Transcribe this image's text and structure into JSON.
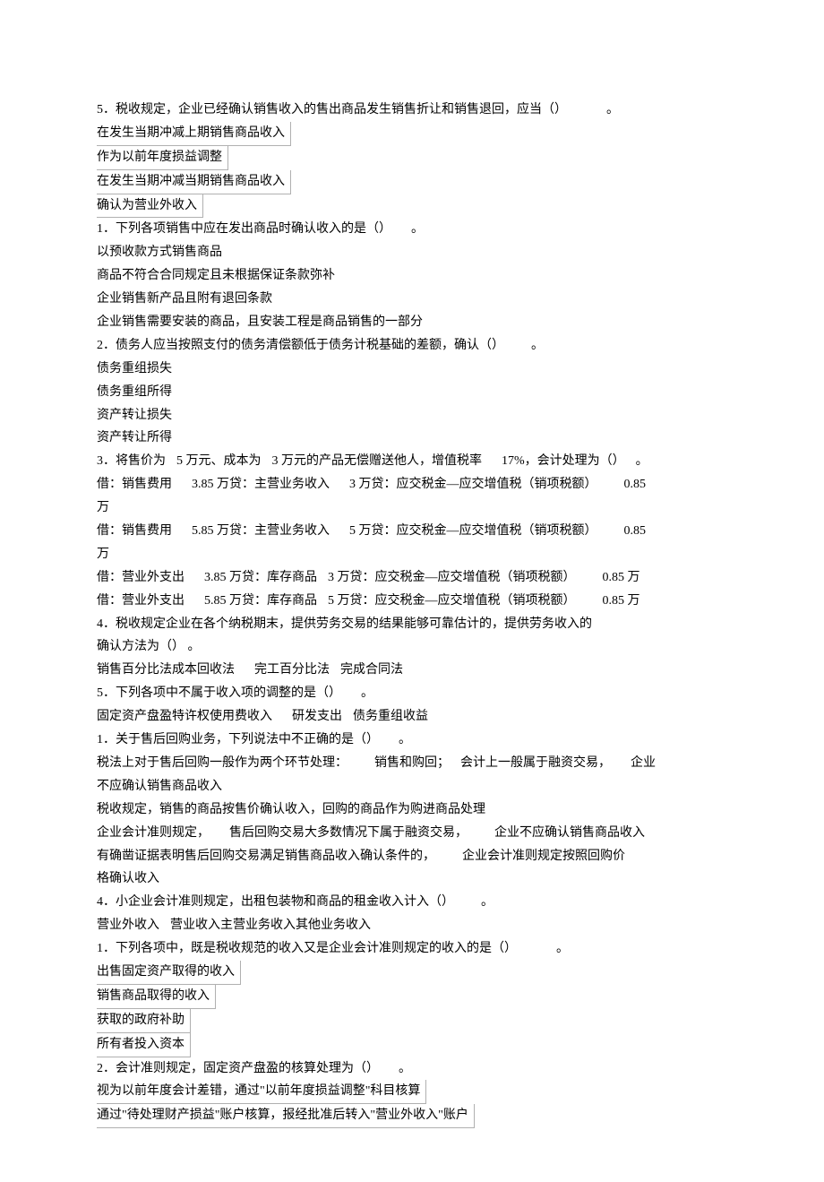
{
  "lines": {
    "l01": "5．税收规定，企业已经确认销售收入的售出商品发生销售折让和销售退回，应当（）",
    "l01b": "。",
    "l02": "在发生当期冲减上期销售商品收入",
    "l03": "作为以前年度损益调整",
    "l04": "在发生当期冲减当期销售商品收入",
    "l05": "确认为营业外收入",
    "l06a": "1．下列各项销售中应在发出商品时确认收入的是（）",
    "l06b": "。",
    "l07": "以预收款方式销售商品",
    "l08": "商品不符合合同规定且未根据保证条款弥补",
    "l09": "企业销售新产品且附有退回条款",
    "l10": "企业销售需要安装的商品，且安装工程是商品销售的一部分",
    "l11a": "2．债务人应当按照支付的债务清偿额低于债务计税基础的差额，确认（）",
    "l11b": "。",
    "l12": "债务重组损失",
    "l13": "债务重组所得",
    "l14": "资产转让损失",
    "l15": "资产转让所得",
    "l16a": "3．将售价为",
    "l16b": "5 万元、成本为",
    "l16c": "3 万元的产品无偿赠送他人，增值税率",
    "l16d": "17%，会计处理为（）",
    "l16e": "。",
    "l17a": "借：销售费用",
    "l17b": "3.85 万贷：主营业务收入",
    "l17c": "3 万贷：应交税金—应交增值税（销项税额）",
    "l17d": "0.85",
    "l17e": "万",
    "l18a": "借：销售费用",
    "l18b": "5.85 万贷：主营业务收入",
    "l18c": "5 万贷：应交税金—应交增值税（销项税额）",
    "l18d": "0.85",
    "l18e": "万",
    "l19a": "借：营业外支出",
    "l19b": "3.85 万贷：库存商品",
    "l19c": "3 万贷：应交税金—应交增值税（销项税额）",
    "l19d": "0.85 万",
    "l20a": "借：营业外支出",
    "l20b": "5.85 万贷：库存商品",
    "l20c": "5 万贷：应交税金—应交增值税（销项税额）",
    "l20d": "0.85 万",
    "l21": "4．税收规定企业在各个纳税期末，提供劳务交易的结果能够可靠估计的，提供劳务收入的",
    "l22": "确认方法为（） 。",
    "l23a": "销售百分比法成本回收法",
    "l23b": "完工百分比法",
    "l23c": "完成合同法",
    "l24a": "5．下列各项中不属于收入项的调整的是（）",
    "l24b": "。",
    "l25a": "固定资产盘盈特许权使用费收入",
    "l25b": "研发支出",
    "l25c": "债务重组收益",
    "l26a": "1．关于售后回购业务，下列说法中不正确的是（）",
    "l26b": "。",
    "l27a": "税法上对于售后回购一般作为两个环节处理：",
    "l27b": "销售和购回；",
    "l27c": "会计上一般属于融资交易，",
    "l27d": "企业",
    "l28": "不应确认销售商品收入",
    "l29": "税收规定，销售的商品按售价确认收入，回购的商品作为购进商品处理",
    "l30a": "企业会计准则规定，",
    "l30b": "售后回购交易大多数情况下属于融资交易，",
    "l30c": "企业不应确认销售商品收入",
    "l31a": "有确凿证据表明售后回购交易满足销售商品收入确认条件的，",
    "l31b": "企业会计准则规定按照回购价",
    "l32": "格确认收入",
    "l33a": "4．小企业会计准则规定，出租包装物和商品的租金收入计入（）",
    "l33b": "。",
    "l34a": "营业外收入",
    "l34b": "营业收入主营业务收入其他业务收入",
    "l35a": "1．下列各项中，既是税收规范的收入又是企业会计准则规定的收入的是（）",
    "l35b": "。",
    "l36": "出售固定资产取得的收入",
    "l37": "销售商品取得的收入",
    "l38": "获取的政府补助",
    "l39": "所有者投入资本",
    "l40a": "2．会计准则规定，固定资产盘盈的核算处理为（）",
    "l40b": "。",
    "l41": "视为以前年度会计差错，通过\"以前年度损益调整\"科目核算",
    "l42": "通过\"待处理财产损益\"账户核算，报经批准后转入\"营业外收入\"账户"
  }
}
